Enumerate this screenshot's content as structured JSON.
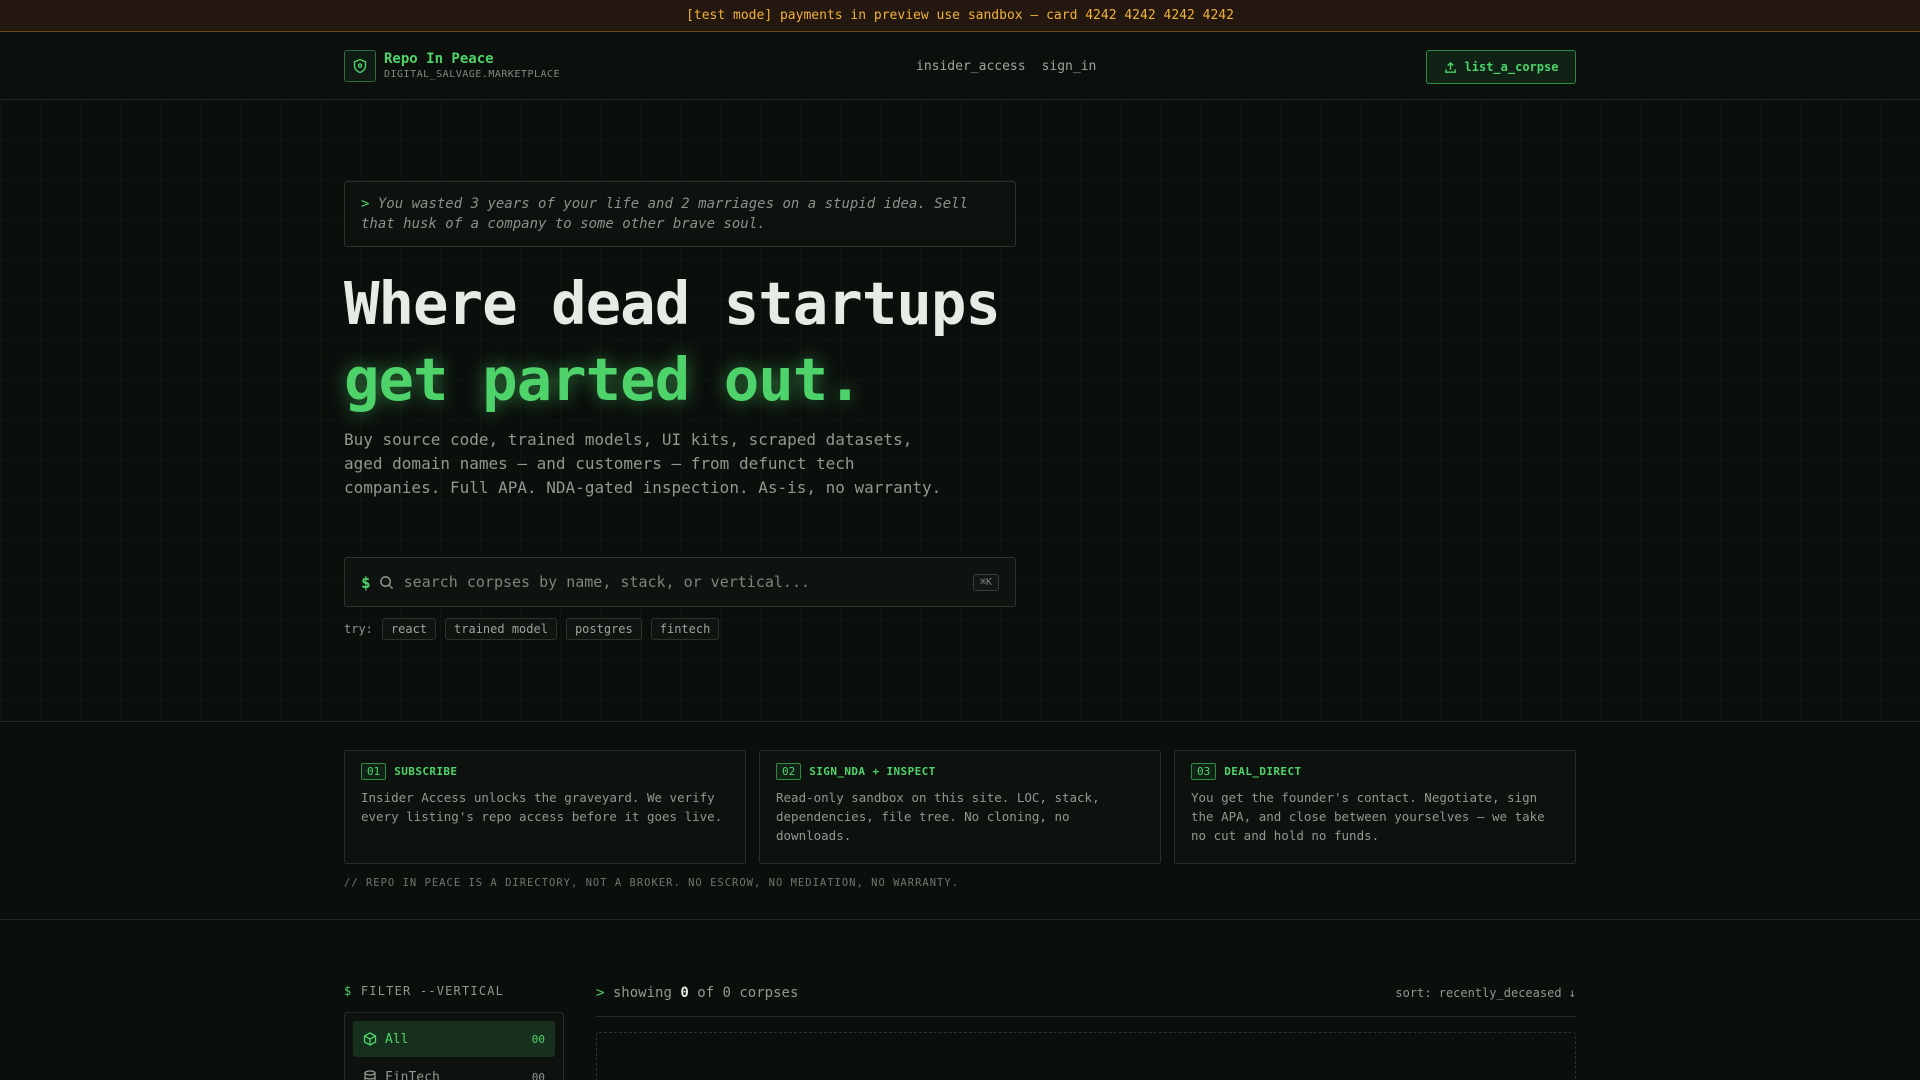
{
  "banner": {
    "text": "[test mode] payments in preview use sandbox — card 4242 4242 4242 4242"
  },
  "nav": {
    "brand_name": "Repo In Peace",
    "brand_sub": "DIGITAL_SALVAGE.MARKETPLACE",
    "logo_icon": "shield-icon",
    "links": [
      "insider_access",
      "sign_in"
    ],
    "cta_label": "list_a_corpse",
    "cta_icon": "upload-icon"
  },
  "hero": {
    "quote_prefix": ">",
    "quote": "You wasted 3 years of your life and 2 marriages on a stupid idea. Sell that husk of a company to some other brave soul.",
    "title_line1": "Where dead startups",
    "title_line2": "get parted out.",
    "description": "Buy source code, trained models, UI kits, scraped datasets, aged domain names — and customers — from defunct tech companies. Full APA. NDA-gated inspection. As-is, no warranty.",
    "search_prompt": "$",
    "search_placeholder": "search corpses by name, stack, or vertical...",
    "search_shortcut": "⌘K",
    "try_label": "try:",
    "suggestions": [
      "react",
      "trained model",
      "postgres",
      "fintech"
    ]
  },
  "steps": [
    {
      "num": "01",
      "title": "SUBSCRIBE",
      "body": "Insider Access unlocks the graveyard. We verify every listing's repo access before it goes live."
    },
    {
      "num": "02",
      "title": "SIGN_NDA + INSPECT",
      "body": "Read-only sandbox on this site. LOC, stack, dependencies, file tree. No cloning, no downloads."
    },
    {
      "num": "03",
      "title": "DEAL_DIRECT",
      "body": "You get the founder's contact. Negotiate, sign the APA, and close between yourselves — we take no cut and hold no funds."
    }
  ],
  "disclaimer": "// REPO IN PEACE IS A DIRECTORY, NOT A BROKER. NO ESCROW, NO MEDIATION, NO WARRANTY.",
  "filter": {
    "prompt": "$",
    "title": "FILTER --VERTICAL",
    "items": [
      {
        "label": "All",
        "count": "00",
        "icon": "cube-icon",
        "active": true
      },
      {
        "label": "FinTech",
        "count": "00",
        "icon": "database-icon",
        "active": false
      }
    ]
  },
  "results": {
    "prefix": ">",
    "showing_label": "showing",
    "shown": "0",
    "of_label": "of",
    "total": "0",
    "unit": "corpses",
    "sort_label": "sort: recently_deceased ↓"
  },
  "colors": {
    "accent": "#4ed36a",
    "banner_text": "#f0b13a",
    "background": "#0b0f0c"
  }
}
